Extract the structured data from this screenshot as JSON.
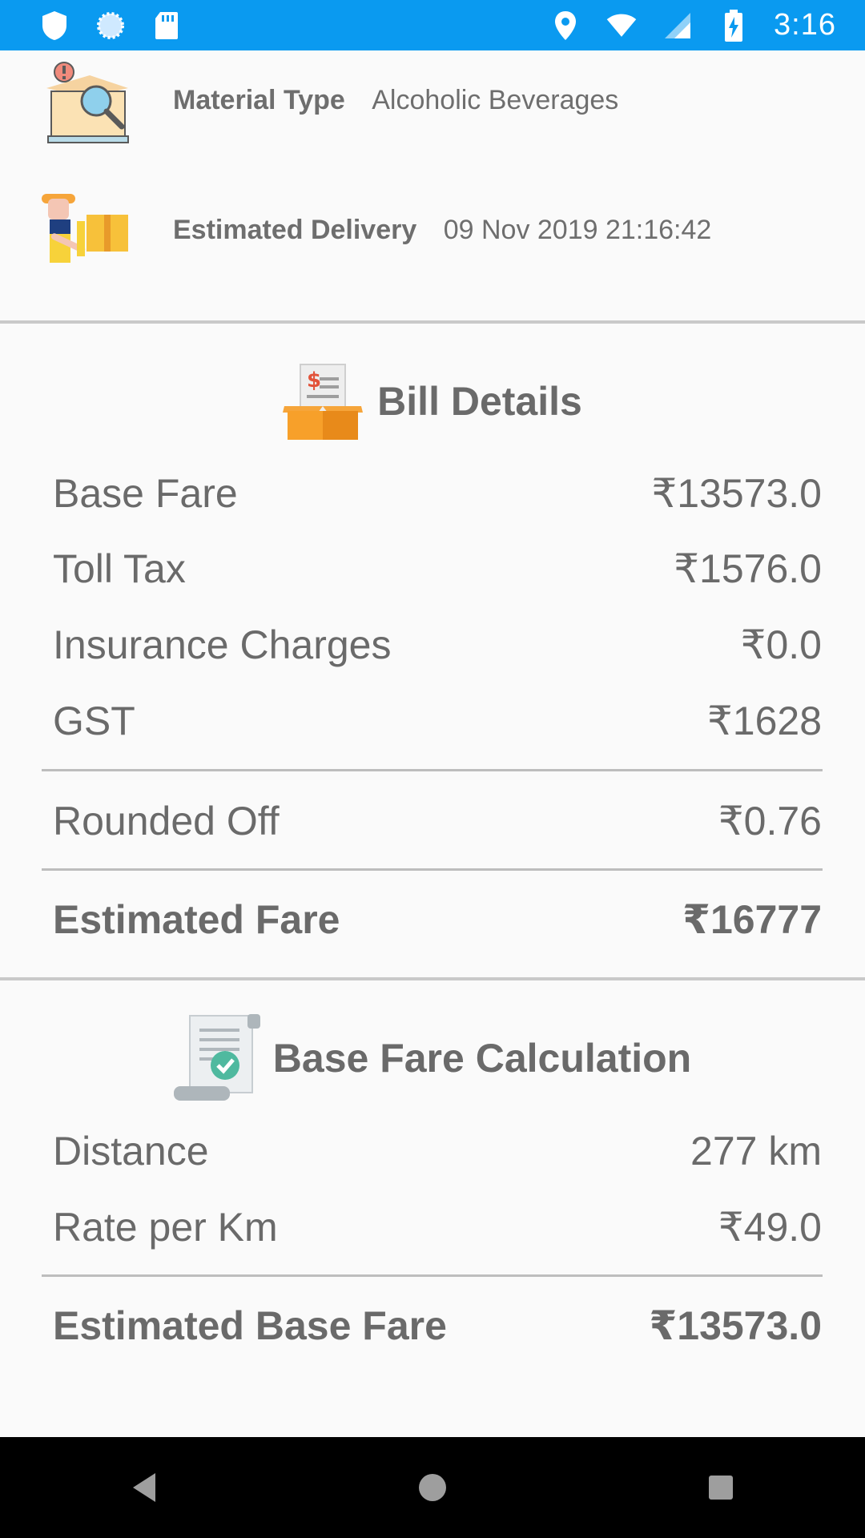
{
  "status_bar": {
    "time": "3:16",
    "left_icons": [
      "shield-icon",
      "loading-circle-icon",
      "sd-card-icon"
    ],
    "right_icons": [
      "location-icon",
      "wifi-icon",
      "signal-icon",
      "battery-charging-icon"
    ]
  },
  "info": {
    "material_type": {
      "label": "Material Type",
      "value": "Alcoholic Beverages",
      "icon": "material-search-box-icon"
    },
    "estimated_delivery": {
      "label": "Estimated Delivery",
      "value": "09 Nov 2019 21:16:42",
      "icon": "delivery-person-icon"
    }
  },
  "bill_details": {
    "title": "Bill Details",
    "icon": "bill-box-icon",
    "rows": [
      {
        "label": "Base Fare",
        "value": "₹13573.0"
      },
      {
        "label": "Toll Tax",
        "value": "₹1576.0"
      },
      {
        "label": "Insurance Charges",
        "value": "₹0.0"
      },
      {
        "label": "GST",
        "value": "₹1628"
      }
    ],
    "rounded_off": {
      "label": "Rounded Off",
      "value": "₹0.76"
    },
    "estimated_fare": {
      "label": "Estimated Fare",
      "value": "₹16777"
    }
  },
  "base_fare_calc": {
    "title": "Base Fare Calculation",
    "icon": "document-check-icon",
    "rows": [
      {
        "label": "Distance",
        "value": "277 km"
      },
      {
        "label": "Rate per Km",
        "value": "₹49.0"
      }
    ],
    "estimated_base_fare": {
      "label": "Estimated Base Fare",
      "value": "₹13573.0"
    }
  },
  "nav": [
    "back-icon",
    "home-icon",
    "recents-icon"
  ]
}
